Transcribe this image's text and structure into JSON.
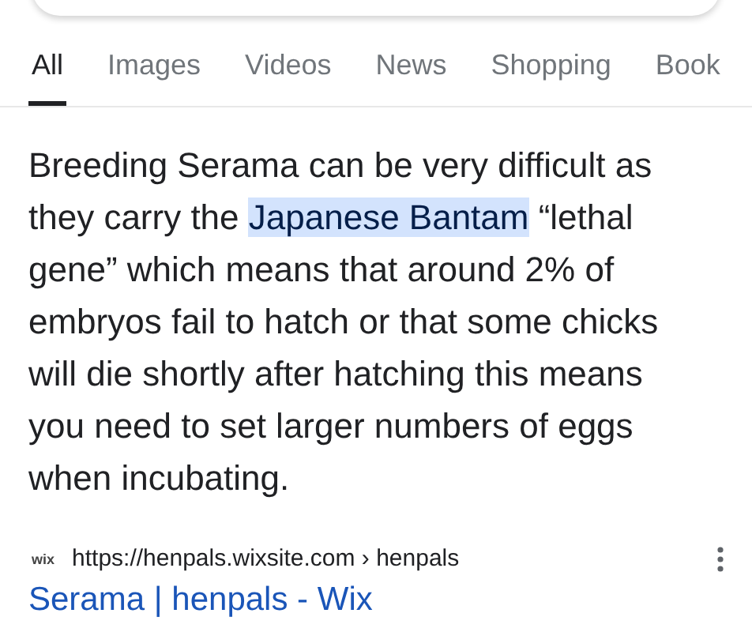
{
  "tabs": [
    {
      "label": "All",
      "selected": true
    },
    {
      "label": "Images",
      "selected": false
    },
    {
      "label": "Videos",
      "selected": false
    },
    {
      "label": "News",
      "selected": false
    },
    {
      "label": "Shopping",
      "selected": false
    },
    {
      "label": "Book",
      "selected": false
    }
  ],
  "snippet": [
    {
      "text": "Breeding Serama can be very difficult as they carry the ",
      "highlighted": false
    },
    {
      "text": "Japanese Bantam",
      "highlighted": true
    },
    {
      "text": " “lethal gene” which means that around 2% of embryos fail to hatch or that some chicks will die shortly after hatching this means you need to set larger numbers of eggs when incubating.",
      "highlighted": false
    }
  ],
  "result": {
    "favicon": "wix",
    "url": "https://henpals.wixsite.com › henpals",
    "title": "Serama | henpals - Wix"
  }
}
